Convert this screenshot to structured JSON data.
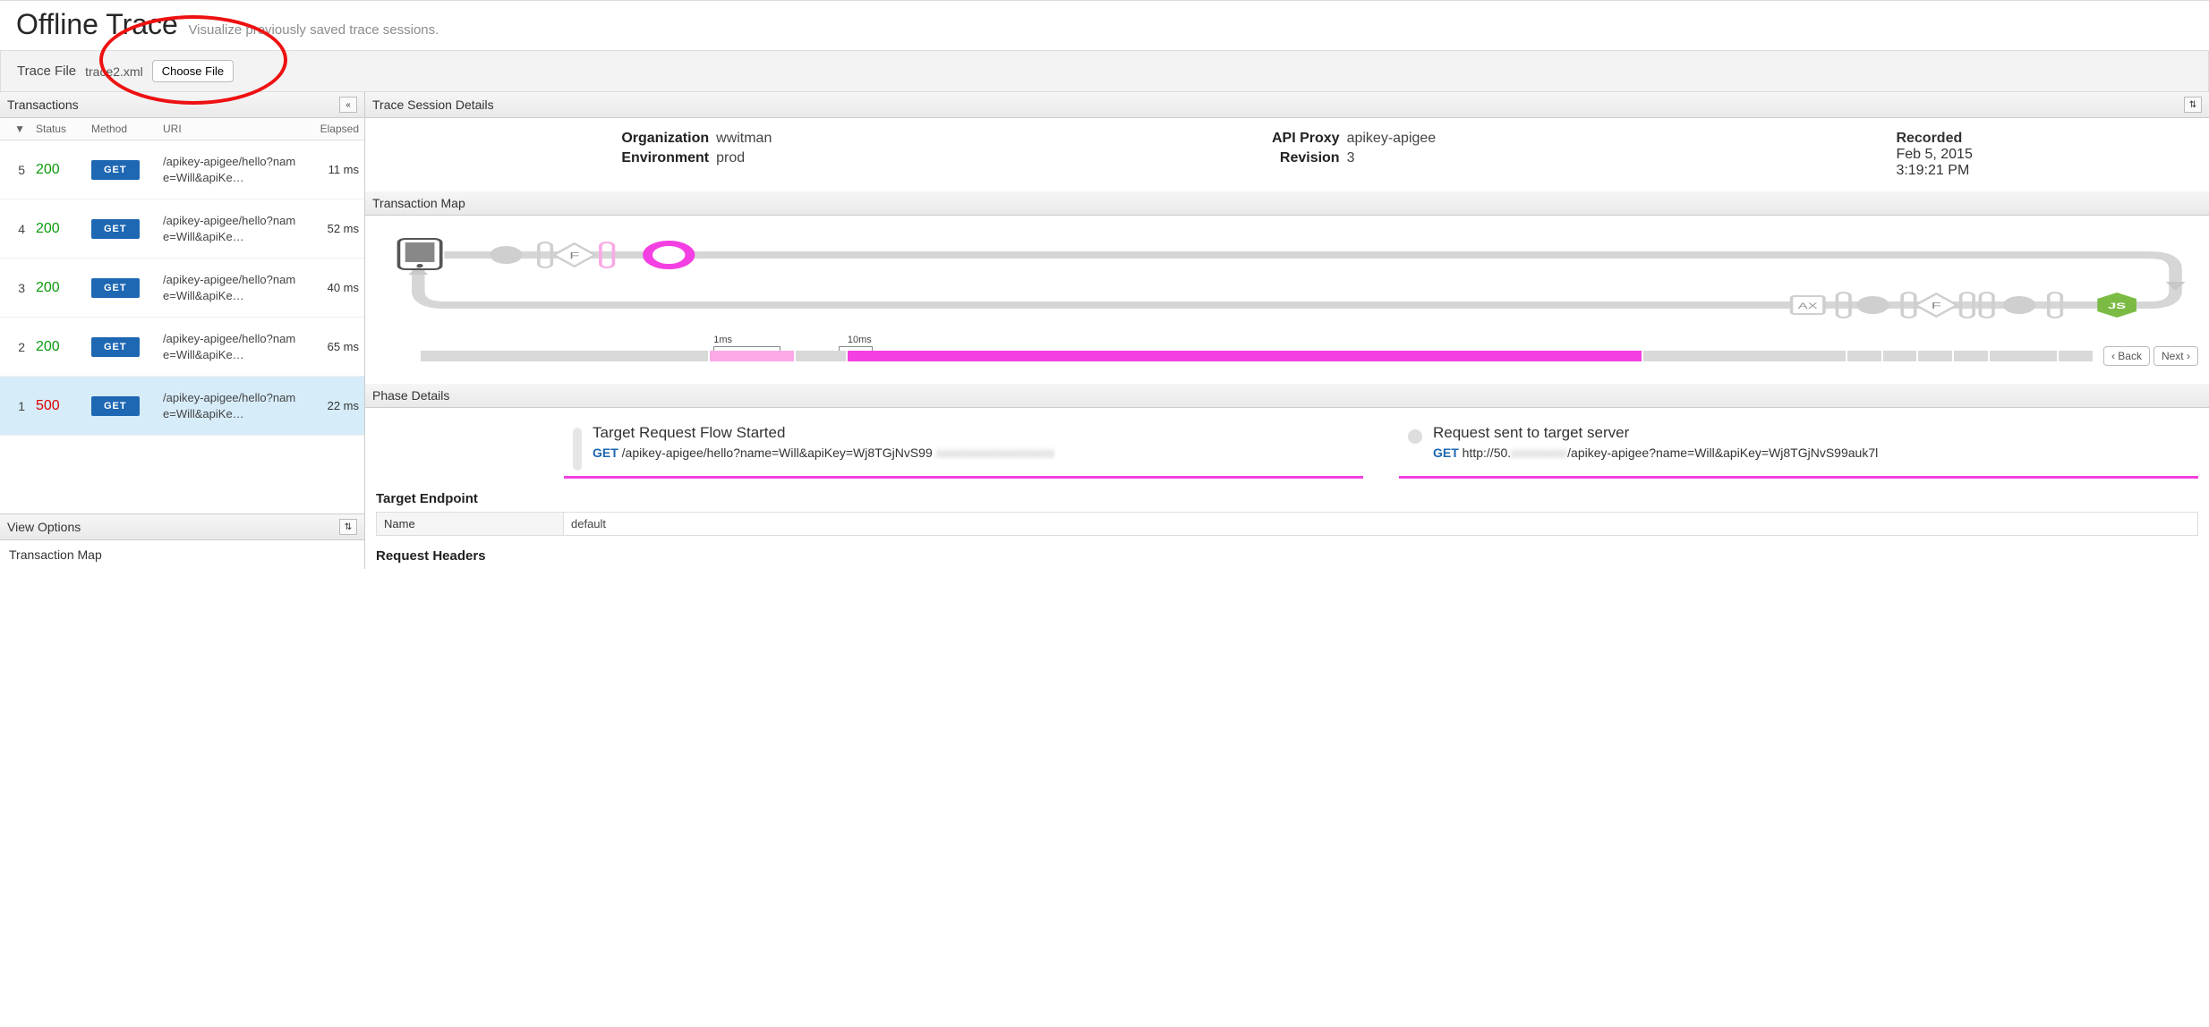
{
  "header": {
    "title": "Offline Trace",
    "subtitle": "Visualize previously saved trace sessions."
  },
  "tracefile": {
    "label": "Trace File",
    "filename": "trace2.xml",
    "choose_btn": "Choose File"
  },
  "transactions": {
    "title": "Transactions",
    "columns": {
      "sort": "▼",
      "status": "Status",
      "method": "Method",
      "uri": "URI",
      "elapsed": "Elapsed"
    },
    "rows": [
      {
        "idx": "5",
        "status": "200",
        "status_class": "ok",
        "method": "GET",
        "uri": "/apikey-apigee/hello?name=Will&apiKe…",
        "elapsed": "11 ms",
        "selected": false
      },
      {
        "idx": "4",
        "status": "200",
        "status_class": "ok",
        "method": "GET",
        "uri": "/apikey-apigee/hello?name=Will&apiKe…",
        "elapsed": "52 ms",
        "selected": false
      },
      {
        "idx": "3",
        "status": "200",
        "status_class": "ok",
        "method": "GET",
        "uri": "/apikey-apigee/hello?name=Will&apiKe…",
        "elapsed": "40 ms",
        "selected": false
      },
      {
        "idx": "2",
        "status": "200",
        "status_class": "ok",
        "method": "GET",
        "uri": "/apikey-apigee/hello?name=Will&apiKe…",
        "elapsed": "65 ms",
        "selected": false
      },
      {
        "idx": "1",
        "status": "500",
        "status_class": "err",
        "method": "GET",
        "uri": "/apikey-apigee/hello?name=Will&apiKe…",
        "elapsed": "22 ms",
        "selected": true
      }
    ]
  },
  "view_options": {
    "title": "View Options",
    "sub1": "Transaction Map"
  },
  "details": {
    "title": "Trace Session Details",
    "meta": {
      "organization_k": "Organization",
      "organization_v": "wwitman",
      "environment_k": "Environment",
      "environment_v": "prod",
      "apiproxy_k": "API Proxy",
      "apiproxy_v": "apikey-apigee",
      "revision_k": "Revision",
      "revision_v": "3",
      "recorded_k": "Recorded",
      "recorded_date": "Feb 5, 2015",
      "recorded_time": "3:19:21 PM"
    }
  },
  "tmap": {
    "title": "Transaction Map",
    "tlabel1": "1ms",
    "tlabel2": "10ms",
    "back": "Back",
    "next": "Next"
  },
  "phase": {
    "title": "Phase Details",
    "cards": [
      {
        "title": "Target Request Flow Started",
        "method": "GET",
        "path": "/apikey-apigee/hello?name=Will&apiKey=Wj8TGjNvS99",
        "path_blur": " xxxxxxxxxxxxxxxxxxx"
      },
      {
        "title": "Request sent to target server",
        "method": "GET",
        "path_pre": "http://50.",
        "path_blur": "xxxxxxxxx",
        "path_post": "/apikey-apigee?name=Will&apiKey=Wj8TGjNvS99auk7l"
      }
    ]
  },
  "target": {
    "title": "Target Endpoint",
    "name_k": "Name",
    "name_v": "default"
  },
  "req_headers": {
    "title": "Request Headers"
  }
}
